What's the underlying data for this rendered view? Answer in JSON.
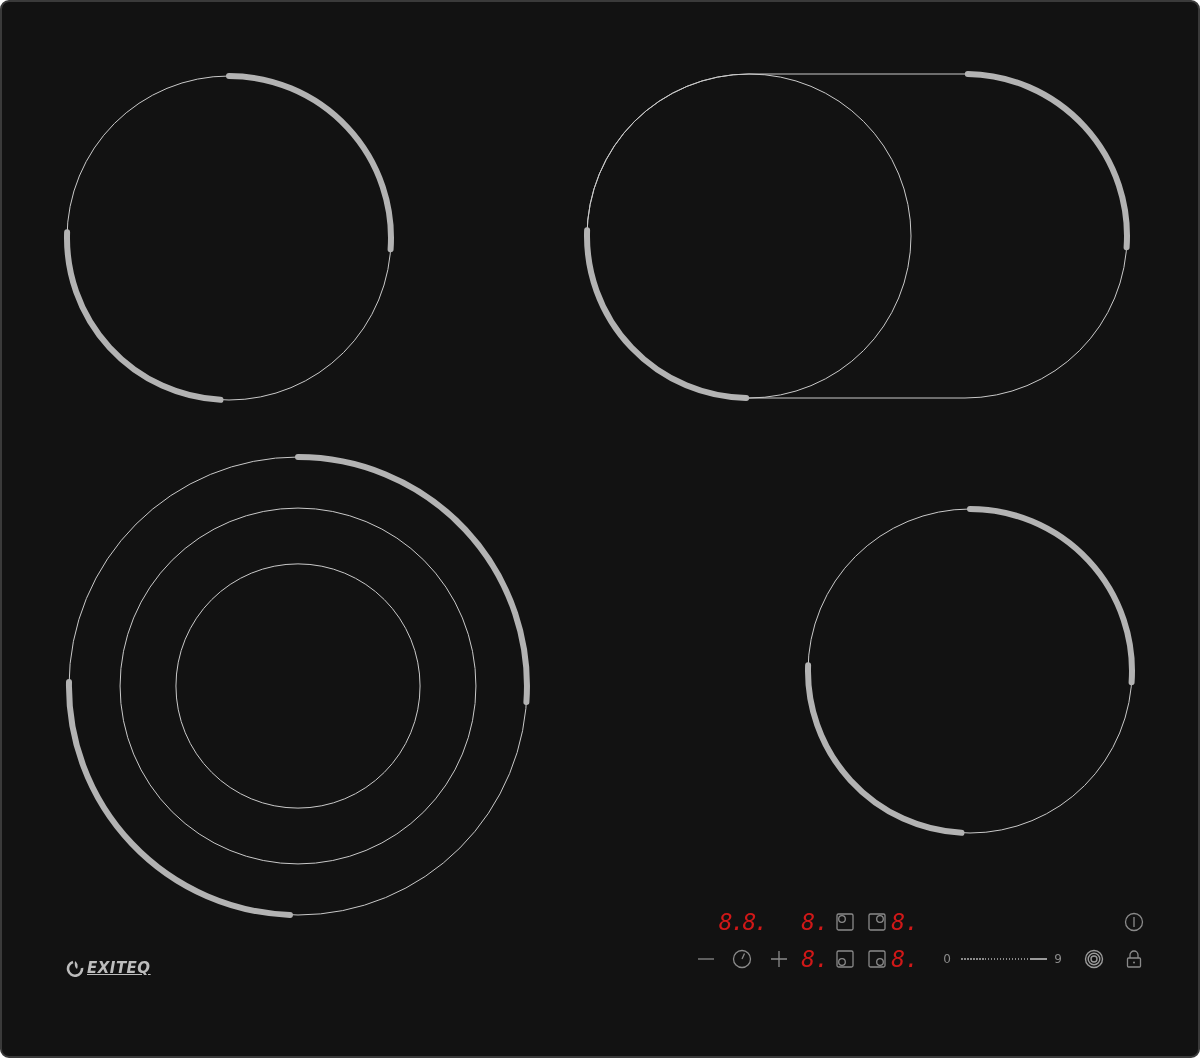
{
  "zones": [
    {
      "kind": "single"
    },
    {
      "kind": "dual"
    },
    {
      "kind": "triple"
    },
    {
      "kind": "single"
    }
  ],
  "controls": {
    "timer_display": "8.8.",
    "zone_displays": [
      "8.",
      "8.",
      "8.",
      "8."
    ],
    "slider": {
      "min_label": "0",
      "max_label": "9",
      "level": 0.8
    }
  },
  "brand": {
    "name": "EXITEQ"
  }
}
